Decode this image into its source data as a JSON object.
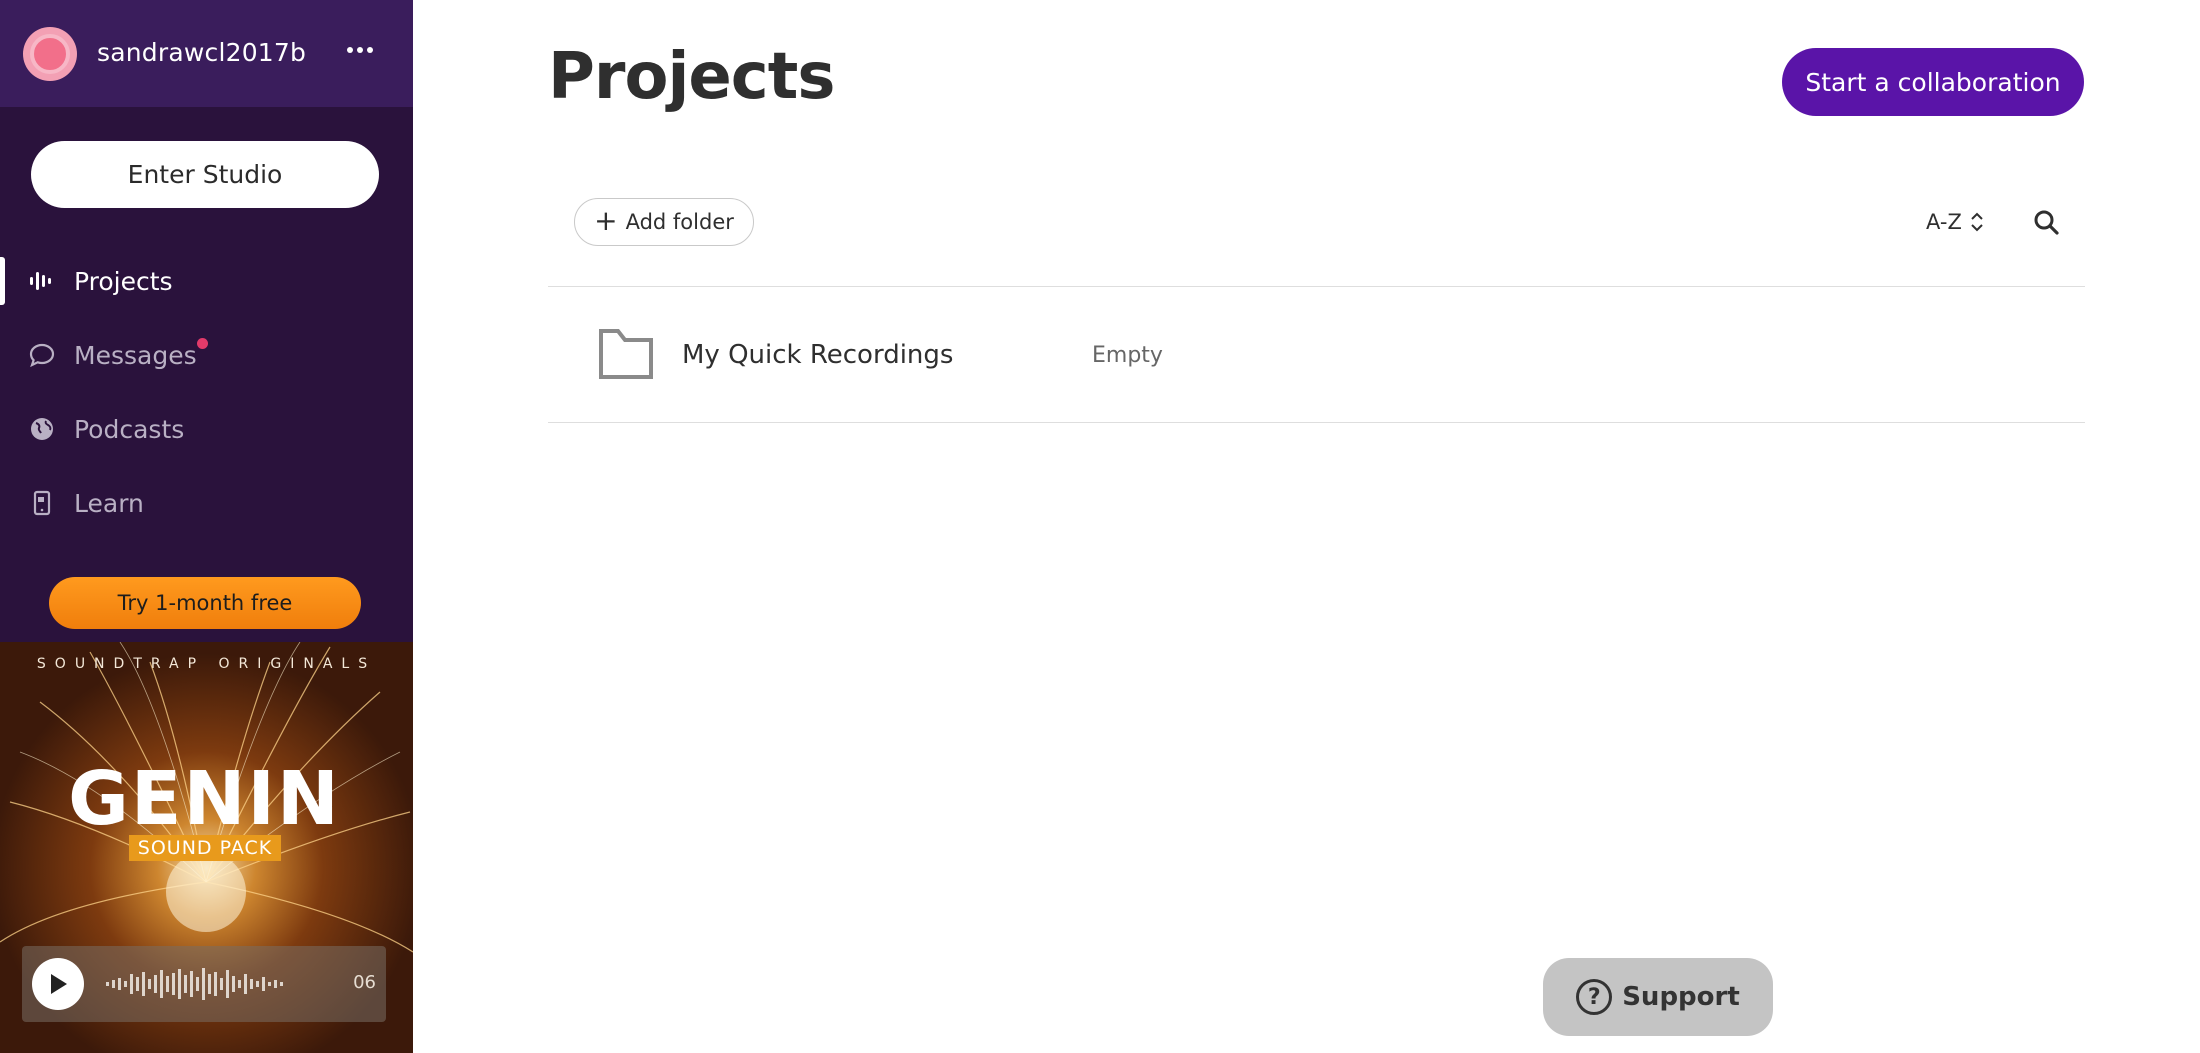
{
  "sidebar": {
    "username": "sandrawcl2017b",
    "enter_studio_label": "Enter Studio",
    "nav_items": [
      {
        "label": "Projects",
        "icon": "waveform-icon",
        "active": true
      },
      {
        "label": "Messages",
        "icon": "chat-bubble-icon",
        "active": false,
        "notification": true
      },
      {
        "label": "Podcasts",
        "icon": "globe-icon",
        "active": false
      },
      {
        "label": "Learn",
        "icon": "tablet-icon",
        "active": false
      }
    ],
    "trial_label": "Try 1-month free",
    "promo": {
      "kicker": "SOUNDTRAP ORIGINALS",
      "title": "GENIN",
      "subtitle": "SOUND PACK",
      "time": "06"
    }
  },
  "main": {
    "title": "Projects",
    "collab_label": "Start a collaboration",
    "add_folder_label": "Add folder",
    "sort_label": "A-Z",
    "folders": [
      {
        "name": "My Quick Recordings",
        "status": "Empty"
      }
    ]
  },
  "support_label": "Support",
  "colors": {
    "sidebar_bg": "#2a123c",
    "user_bar_bg": "#3a1d5c",
    "accent_purple": "#5a14a8",
    "trial_orange": "#f7890f",
    "notification_red": "#e23a6a"
  }
}
